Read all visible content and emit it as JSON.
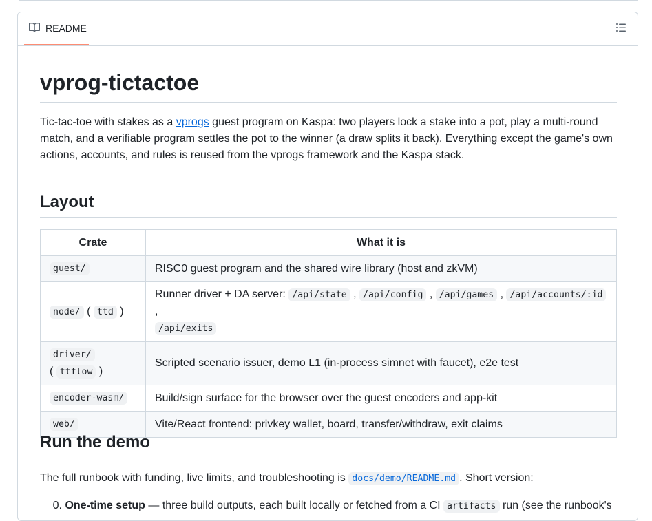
{
  "header": {
    "tab_label": "README",
    "book_icon": "book-icon",
    "outline_icon": "list-unordered-icon"
  },
  "title": "vprog-tictactoe",
  "intro": {
    "before_link": "Tic-tac-toe with stakes as a ",
    "link_text": "vprogs",
    "after_link": " guest program on Kaspa: two players lock a stake into a pot, play a multi-round match, and a verifiable program settles the pot to the winner (a draw splits it back). Everything except the game's own actions, accounts, and rules is reused from the vprogs framework and the Kaspa stack."
  },
  "layout_heading": "Layout",
  "table": {
    "headers": [
      "Crate",
      "What it is"
    ],
    "rows": [
      {
        "crate": "guest/",
        "desc": "RISC0 guest program and the shared wire library (host and zkVM)"
      },
      {
        "crate": "node/",
        "crate_alias": "ttd",
        "desc_prefix": "Runner driver + DA server: ",
        "codes": [
          "/api/state",
          "/api/config",
          "/api/games",
          "/api/accounts/:id",
          "/api/exits"
        ]
      },
      {
        "crate": "driver/",
        "crate_alias": "ttflow",
        "desc": "Scripted scenario issuer, demo L1 (in-process simnet with faucet), e2e test"
      },
      {
        "crate": "encoder-wasm/",
        "desc": "Build/sign surface for the browser over the guest encoders and app-kit"
      },
      {
        "crate": "web/",
        "desc": "Vite/React frontend: privkey wallet, board, transfer/withdraw, exit claims"
      }
    ]
  },
  "run_heading": "Run the demo",
  "runbook": {
    "before": "The full runbook with funding, live limits, and troubleshooting is ",
    "link_code": "docs/demo/README.md",
    "after": ". Short version:"
  },
  "step0": {
    "number": "0.",
    "bold": "One-time setup",
    "text1": " — three build outputs, each built locally or fetched from a CI ",
    "code": "artifacts",
    "text2": " run (see the runbook's"
  }
}
